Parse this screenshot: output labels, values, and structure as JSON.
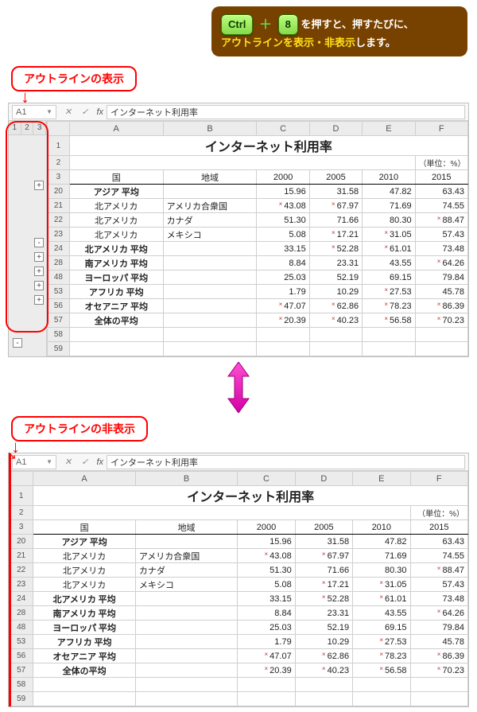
{
  "tip": {
    "key1": "Ctrl",
    "key2": "8",
    "text1": "を押すと、押すたびに、",
    "text2": "アウトラインを表示・非表示",
    "text3": "します。"
  },
  "callout_show": "アウトラインの表示",
  "callout_hide": "アウトラインの非表示",
  "namebox": "A1",
  "fx_label": "fx",
  "formula_value": "インターネット利用率",
  "outline_levels": [
    "1",
    "2",
    "3"
  ],
  "col_heads": [
    "",
    "A",
    "B",
    "C",
    "D",
    "E",
    "F"
  ],
  "title": "インターネット利用率",
  "unit": "（単位：%）",
  "headers": {
    "country": "国",
    "region": "地域",
    "y2000": "2000",
    "y2005": "2005",
    "y2010": "2010",
    "y2015": "2015"
  },
  "rows": [
    {
      "n": "20",
      "a": "アジア 平均",
      "bold": true,
      "b": "",
      "v": [
        {
          "t": "15.96"
        },
        {
          "t": "31.58"
        },
        {
          "t": "47.82"
        },
        {
          "t": "63.43"
        }
      ]
    },
    {
      "n": "21",
      "a": "北アメリカ",
      "b": "アメリカ合衆国",
      "v": [
        {
          "t": "43.08",
          "m": 1
        },
        {
          "t": "67.97",
          "m": 1
        },
        {
          "t": "71.69"
        },
        {
          "t": "74.55"
        }
      ]
    },
    {
      "n": "22",
      "a": "北アメリカ",
      "b": "カナダ",
      "v": [
        {
          "t": "51.30"
        },
        {
          "t": "71.66"
        },
        {
          "t": "80.30"
        },
        {
          "t": "88.47",
          "m": 1
        }
      ]
    },
    {
      "n": "23",
      "a": "北アメリカ",
      "b": "メキシコ",
      "v": [
        {
          "t": "5.08"
        },
        {
          "t": "17.21",
          "m": 1
        },
        {
          "t": "31.05",
          "m": 1
        },
        {
          "t": "57.43"
        }
      ]
    },
    {
      "n": "24",
      "a": "北アメリカ 平均",
      "bold": true,
      "b": "",
      "v": [
        {
          "t": "33.15"
        },
        {
          "t": "52.28",
          "m": 1
        },
        {
          "t": "61.01",
          "m": 1
        },
        {
          "t": "73.48"
        }
      ]
    },
    {
      "n": "28",
      "a": "南アメリカ 平均",
      "bold": true,
      "b": "",
      "v": [
        {
          "t": "8.84"
        },
        {
          "t": "23.31"
        },
        {
          "t": "43.55"
        },
        {
          "t": "64.26",
          "m": 1
        }
      ]
    },
    {
      "n": "48",
      "a": "ヨーロッパ 平均",
      "bold": true,
      "b": "",
      "v": [
        {
          "t": "25.03"
        },
        {
          "t": "52.19"
        },
        {
          "t": "69.15"
        },
        {
          "t": "79.84"
        }
      ]
    },
    {
      "n": "53",
      "a": "アフリカ 平均",
      "bold": true,
      "b": "",
      "v": [
        {
          "t": "1.79"
        },
        {
          "t": "10.29"
        },
        {
          "t": "27.53",
          "m": 1
        },
        {
          "t": "45.78"
        }
      ]
    },
    {
      "n": "56",
      "a": "オセアニア 平均",
      "bold": true,
      "b": "",
      "v": [
        {
          "t": "47.07",
          "m": 1
        },
        {
          "t": "62.86",
          "m": 1
        },
        {
          "t": "78.23",
          "m": 1
        },
        {
          "t": "86.39",
          "m": 1
        }
      ]
    },
    {
      "n": "57",
      "a": "全体の平均",
      "bold": true,
      "b": "",
      "v": [
        {
          "t": "20.39",
          "m": 1
        },
        {
          "t": "40.23",
          "m": 1
        },
        {
          "t": "56.58",
          "m": 1
        },
        {
          "t": "70.23",
          "m": 1
        }
      ]
    }
  ],
  "tail_rows": [
    "58",
    "59"
  ],
  "outline_buttons1": [
    "+",
    "",
    "",
    "",
    "-",
    "+",
    "+",
    "+",
    "+",
    "",
    ""
  ],
  "chart_data": {
    "type": "table",
    "title": "インターネット利用率",
    "unit": "%",
    "columns": [
      "国",
      "地域",
      "2000",
      "2005",
      "2010",
      "2015"
    ],
    "data": [
      [
        "アジア 平均",
        "",
        15.96,
        31.58,
        47.82,
        63.43
      ],
      [
        "北アメリカ",
        "アメリカ合衆国",
        43.08,
        67.97,
        71.69,
        74.55
      ],
      [
        "北アメリカ",
        "カナダ",
        51.3,
        71.66,
        80.3,
        88.47
      ],
      [
        "北アメリカ",
        "メキシコ",
        5.08,
        17.21,
        31.05,
        57.43
      ],
      [
        "北アメリカ 平均",
        "",
        33.15,
        52.28,
        61.01,
        73.48
      ],
      [
        "南アメリカ 平均",
        "",
        8.84,
        23.31,
        43.55,
        64.26
      ],
      [
        "ヨーロッパ 平均",
        "",
        25.03,
        52.19,
        69.15,
        79.84
      ],
      [
        "アフリカ 平均",
        "",
        1.79,
        10.29,
        27.53,
        45.78
      ],
      [
        "オセアニア 平均",
        "",
        47.07,
        62.86,
        78.23,
        86.39
      ],
      [
        "全体の平均",
        "",
        20.39,
        40.23,
        56.58,
        70.23
      ]
    ]
  }
}
